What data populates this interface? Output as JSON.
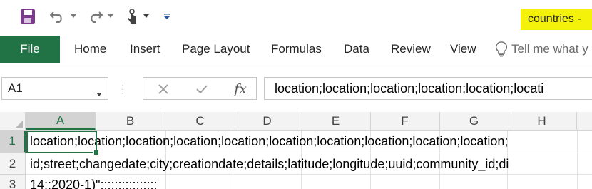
{
  "quick_access": {
    "save_icon": "save-icon",
    "undo_icon": "undo-icon",
    "redo_icon": "redo-icon",
    "touch_mode_icon": "touch-mode-icon",
    "customize_icon": "customize-qat-icon"
  },
  "title": "countries -",
  "title_highlight_color": "#f4f20a",
  "ribbon": {
    "file": "File",
    "tabs": [
      "Home",
      "Insert",
      "Page Layout",
      "Formulas",
      "Data",
      "Review",
      "View"
    ],
    "tell_me": "Tell me what y",
    "accent_color": "#217346"
  },
  "formula_bar": {
    "name_box": "A1",
    "cancel_icon": "cancel-icon",
    "enter_icon": "enter-icon",
    "fx_icon": "fx-icon",
    "fx_label": "fx",
    "content": "location;location;location;location;location;locati"
  },
  "grid": {
    "columns": [
      "A",
      "B",
      "C",
      "D",
      "E",
      "F",
      "G",
      "H"
    ],
    "active_column": "A",
    "rows": [
      {
        "number": "1",
        "text": "location;location;location;location;location;location;location;location;location;location;"
      },
      {
        "number": "2",
        "text": "id;street;changedate;city;creationdate;details;latitude;longitude;uuid;community_id;di"
      },
      {
        "number": "3",
        "text": "14;;2020-1)\";;;;;;;;;;;;;;;;"
      }
    ],
    "active_row": "1",
    "active_cell": "A1"
  }
}
